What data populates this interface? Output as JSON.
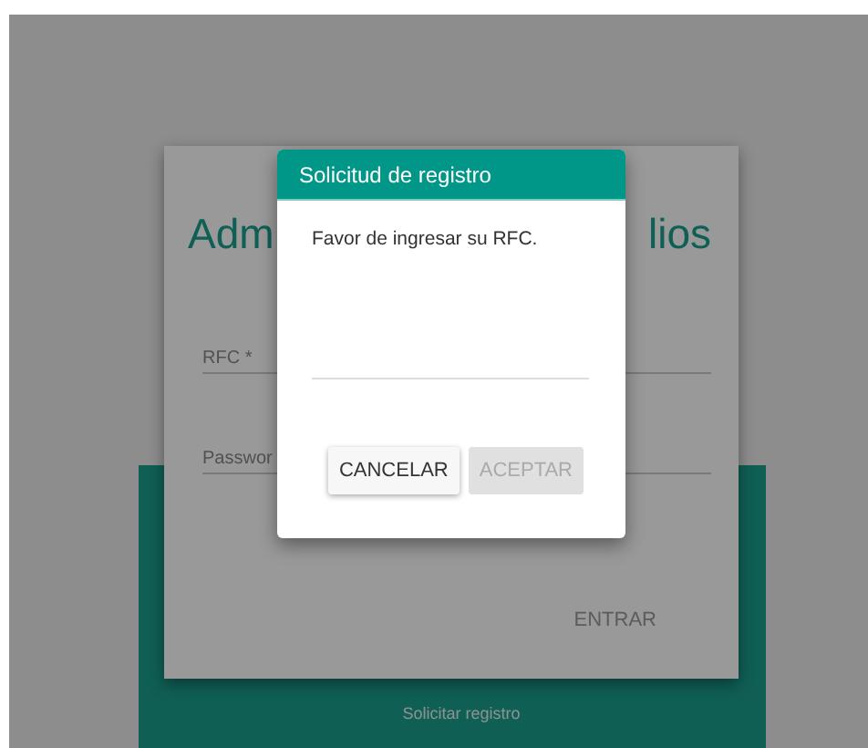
{
  "page": {
    "title_left": "Adm",
    "title_right": "lios",
    "fields": [
      {
        "label": "RFC *"
      },
      {
        "label": "Passwor"
      }
    ],
    "login_button": "ENTRAR",
    "register_link": "Solicitar registro"
  },
  "dialog": {
    "title": "Solicitud de registro",
    "message": "Favor de ingresar su RFC.",
    "buttons": [
      {
        "label": "CANCELAR",
        "disabled": false
      },
      {
        "label": "ACEPTAR",
        "disabled": true
      }
    ]
  }
}
